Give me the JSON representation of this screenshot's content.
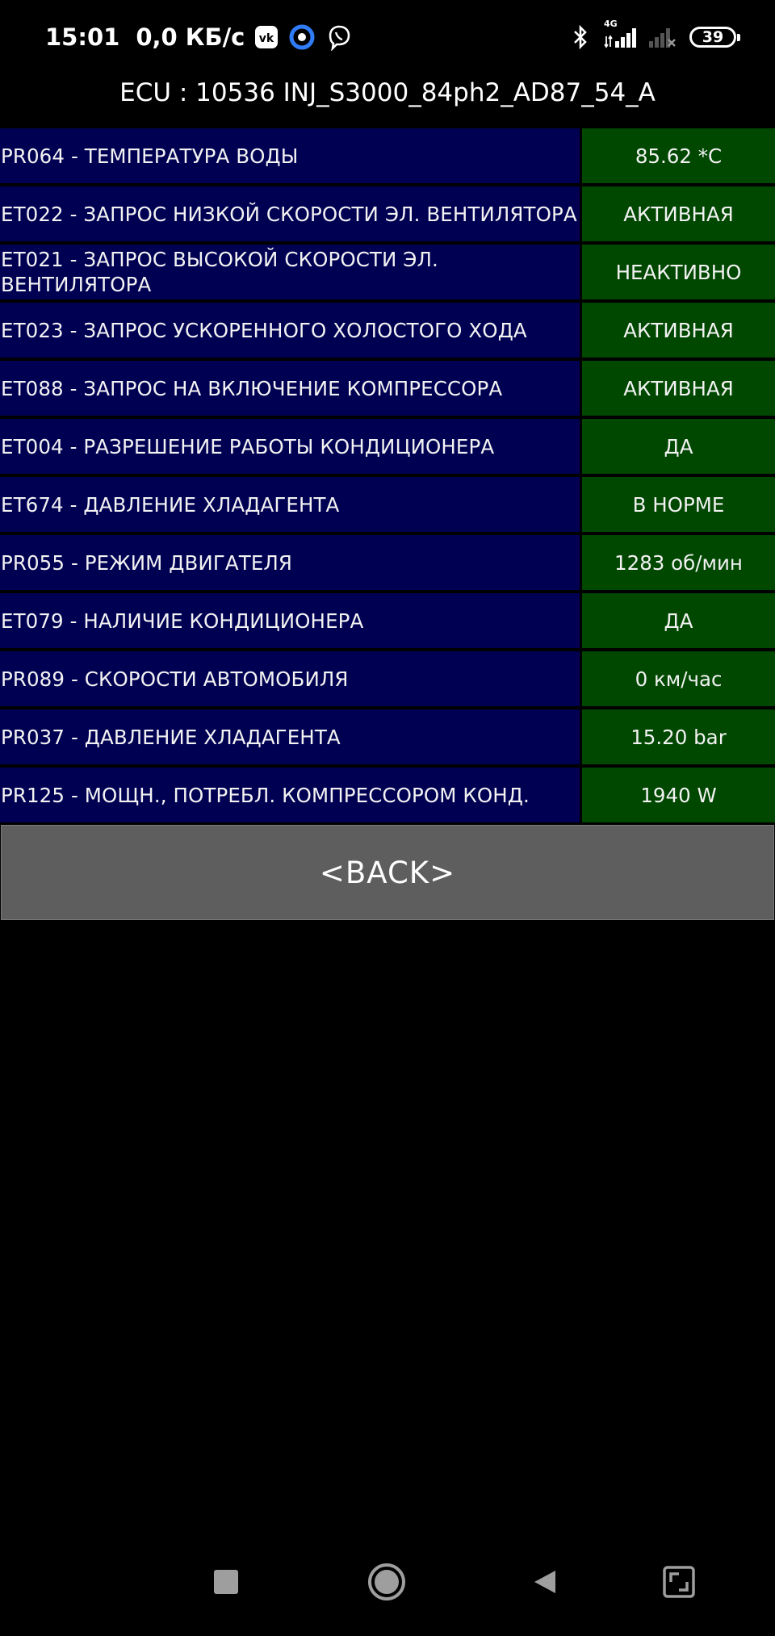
{
  "status_bar": {
    "time": "15:01",
    "net_speed": "0,0 КБ/с",
    "battery": "39",
    "icons": [
      "vk-icon",
      "assistant-icon",
      "viber-icon",
      "bluetooth-icon",
      "signal-4g-icon",
      "signal-no-service-icon",
      "battery-icon"
    ],
    "network_label": "4G"
  },
  "header": {
    "title": "ECU : 10536  INJ_S3000_84ph2_AD87_54_A"
  },
  "params": [
    {
      "label": "PR064 - ТЕМПЕРАТУРА ВОДЫ",
      "value": "85.62 *C"
    },
    {
      "label": "ET022 - ЗАПРОС НИЗКОЙ СКОРОСТИ ЭЛ. ВЕНТИЛЯТОРА",
      "value": "АКТИВНАЯ"
    },
    {
      "label": "ET021 - ЗАПРОС ВЫСОКОЙ СКОРОСТИ ЭЛ. ВЕНТИЛЯТОРА",
      "value": "НЕАКТИВНО"
    },
    {
      "label": "ET023 - ЗАПРОС УСКОРЕННОГО ХОЛОСТОГО ХОДА",
      "value": "АКТИВНАЯ"
    },
    {
      "label": "ET088 - ЗАПРОС НА ВКЛЮЧЕНИЕ КОМПРЕССОРА",
      "value": "АКТИВНАЯ"
    },
    {
      "label": "ET004 - РАЗРЕШЕНИЕ РАБОТЫ КОНДИЦИОНЕРА",
      "value": "ДА"
    },
    {
      "label": "ET674 - ДАВЛЕНИЕ ХЛАДАГЕНТА",
      "value": "В НОРМЕ"
    },
    {
      "label": "PR055 - РЕЖИМ ДВИГАТЕЛЯ",
      "value": "1283 об/мин"
    },
    {
      "label": "ET079 - НАЛИЧИЕ КОНДИЦИОНЕРА",
      "value": "ДА"
    },
    {
      "label": "PR089 - СКОРОСТИ АВТОМОБИЛЯ",
      "value": "0 км/час"
    },
    {
      "label": "PR037 - ДАВЛЕНИЕ ХЛАДАГЕНТА",
      "value": "15.20 bar"
    },
    {
      "label": "PR125 - МОЩН., ПОТРЕБЛ. КОМПРЕССОРОМ КОНД.",
      "value": "1940 W"
    }
  ],
  "back_button": {
    "label": "<BACK>"
  },
  "nav": {
    "icons": [
      "recents-square-icon",
      "home-circle-icon",
      "back-triangle-icon",
      "fullscreen-icon"
    ]
  },
  "colors": {
    "label_bg": "#000053",
    "value_bg": "#004700",
    "button_bg": "#5e5e5e",
    "background": "#000000"
  }
}
